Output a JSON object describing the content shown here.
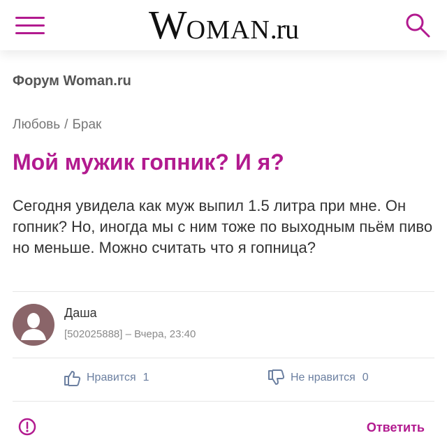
{
  "header": {
    "logo_w": "W",
    "logo_oman": "OMAN",
    "logo_ru": ".ru",
    "menu_icon": "hamburger-menu-icon",
    "search_icon": "search-icon",
    "accent_color": "#b21a8f"
  },
  "forum": {
    "title": "Форум Woman.ru"
  },
  "breadcrumb": {
    "items": [
      "Любовь",
      "Брак"
    ],
    "separator": "/"
  },
  "post": {
    "title": "Мой мужик гопник? И я?",
    "body": "Сегодня увидела как муж выпил 1.5 литра при мне. Он гопник? Но, иногда мы с ним тоже по выходным пьём пиво но меньше. Можно считать что я гопница?",
    "author": "Даша",
    "meta": "[502025888] – Вчера, 23:40"
  },
  "actions": {
    "like_label": "Нравится",
    "like_count": "1",
    "dislike_label": "Не нравится",
    "dislike_count": "0",
    "reply_label": "Ответить",
    "report_icon": "exclamation-circle-icon"
  }
}
